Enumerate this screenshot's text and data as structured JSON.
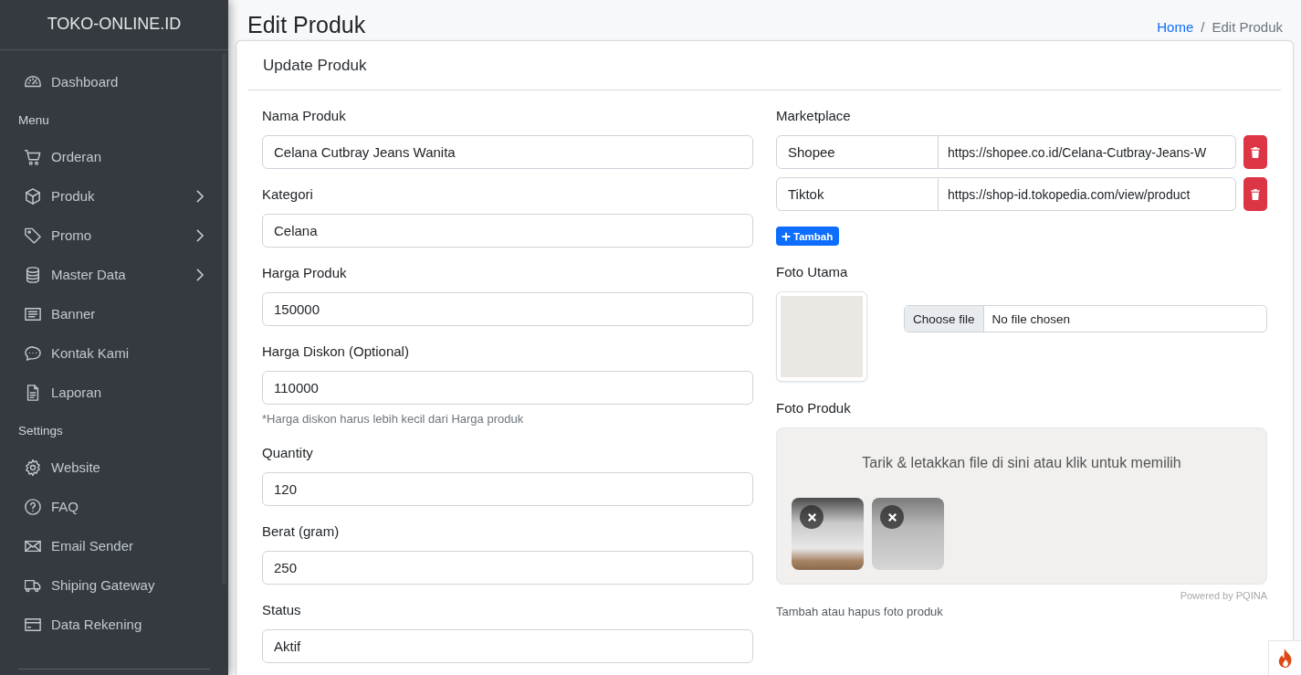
{
  "sidebar": {
    "brand": "TOKO-ONLINE.ID",
    "items": [
      {
        "kind": "link",
        "label": "Dashboard",
        "has_submenu": false
      },
      {
        "kind": "header",
        "label": "Menu"
      },
      {
        "kind": "link",
        "label": "Orderan",
        "has_submenu": false
      },
      {
        "kind": "link",
        "label": "Produk",
        "has_submenu": true
      },
      {
        "kind": "link",
        "label": "Promo",
        "has_submenu": true
      },
      {
        "kind": "link",
        "label": "Master Data",
        "has_submenu": true
      },
      {
        "kind": "link",
        "label": "Banner",
        "has_submenu": false
      },
      {
        "kind": "link",
        "label": "Kontak Kami",
        "has_submenu": false
      },
      {
        "kind": "link",
        "label": "Laporan",
        "has_submenu": false
      },
      {
        "kind": "header",
        "label": "Settings"
      },
      {
        "kind": "link",
        "label": "Website",
        "has_submenu": false
      },
      {
        "kind": "link",
        "label": "FAQ",
        "has_submenu": false
      },
      {
        "kind": "link",
        "label": "Email Sender",
        "has_submenu": false
      },
      {
        "kind": "link",
        "label": "Shiping Gateway",
        "has_submenu": false
      },
      {
        "kind": "link",
        "label": "Data Rekening",
        "has_submenu": false
      }
    ]
  },
  "header": {
    "title": "Edit Produk",
    "separator": "/",
    "breadcrumb": [
      {
        "kind": "link",
        "label": "Home"
      },
      {
        "kind": "current",
        "label": "Edit Produk"
      }
    ]
  },
  "card": {
    "title": "Update Produk",
    "fields": [
      {
        "label": "Nama Produk",
        "value": "Celana Cutbray Jeans Wanita"
      },
      {
        "label": "Kategori",
        "value": "Celana"
      },
      {
        "label": "Harga Produk",
        "value": "150000"
      },
      {
        "label": "Harga Diskon (Optional)",
        "value": "110000",
        "help": "*Harga diskon harus lebih kecil dari Harga produk"
      },
      {
        "label": "Quantity",
        "value": "120"
      },
      {
        "label": "Berat (gram)",
        "value": "250"
      },
      {
        "label": "Status",
        "value": "Aktif"
      }
    ],
    "marketplace": {
      "label": "Marketplace",
      "rows": [
        {
          "name": "Shopee",
          "url": "https://shopee.co.id/Celana-Cutbray-Jeans-W"
        },
        {
          "name": "Tiktok",
          "url": "https://shop-id.tokopedia.com/view/product"
        }
      ],
      "add_button": "Tambah"
    },
    "main_photo": {
      "label": "Foto Utama",
      "file_button": "Choose file",
      "file_status": "No file chosen"
    },
    "product_photos": {
      "label": "Foto Produk",
      "drop_text": "Tarik & letakkan file di sini atau klik untuk memilih",
      "credit": "Powered by PQINA",
      "help": "Tambah atau hapus foto produk"
    }
  }
}
